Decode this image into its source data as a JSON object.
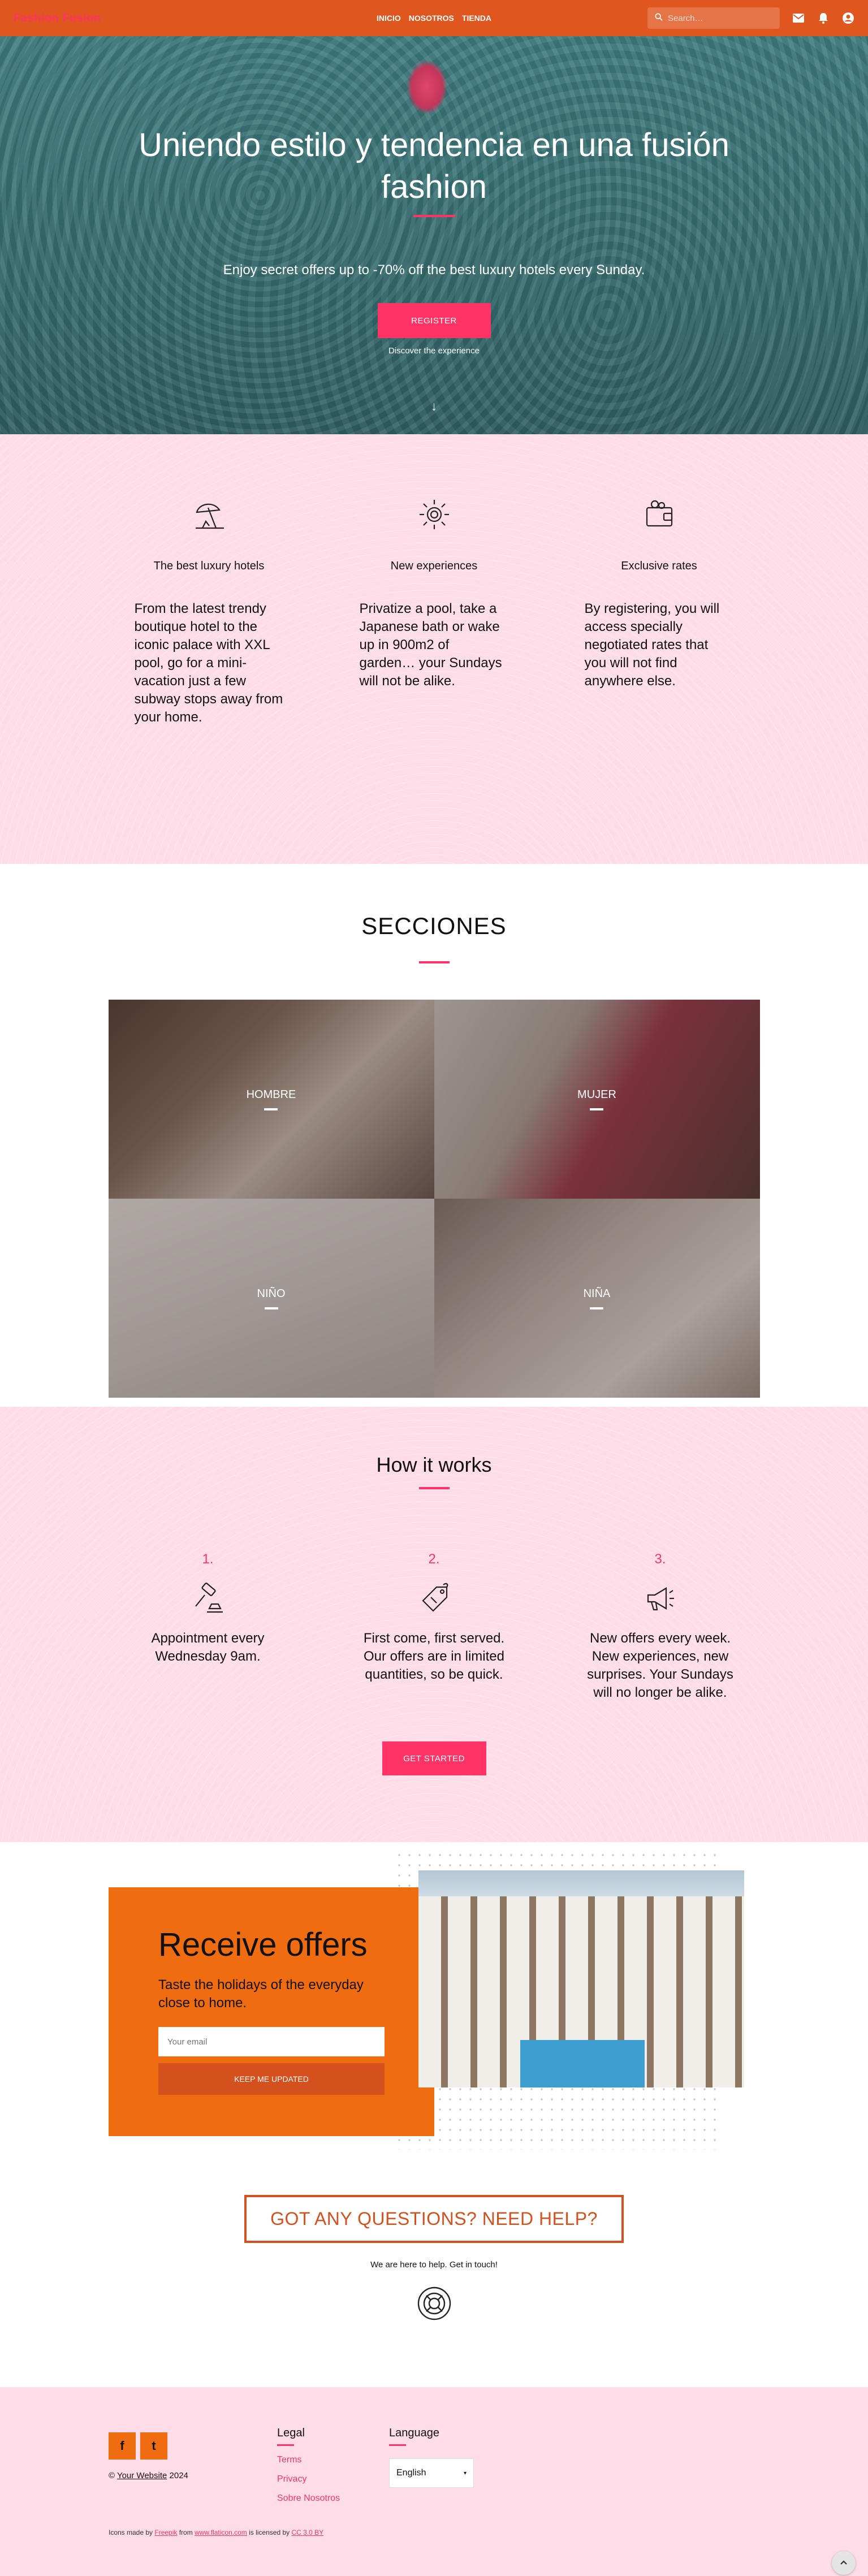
{
  "header": {
    "brand": "Fashion Fusion",
    "nav": [
      "INICIO",
      "NOSOTROS",
      "TIENDA"
    ],
    "search_placeholder": "Search…"
  },
  "hero": {
    "title": "Uniendo estilo y tendencia en una fusión fashion",
    "subtitle": "Enjoy secret offers up to -70% off the best luxury hotels every Sunday.",
    "cta": "REGISTER",
    "discover": "Discover the experience",
    "scroll_arrow": "↓"
  },
  "values": [
    {
      "icon": "beach-umbrella-icon",
      "title": "The best luxury hotels",
      "text": "From the latest trendy boutique hotel to the iconic palace with XXL pool, go for a mini-vacation just a few subway stops away from your home."
    },
    {
      "icon": "sun-icon",
      "title": "New experiences",
      "text": "Privatize a pool, take a Japanese bath or wake up in 900m2 of garden… your Sundays will not be alike."
    },
    {
      "icon": "wallet-icon",
      "title": "Exclusive rates",
      "text": "By registering, you will access specially negotiated rates that you will not find anywhere else."
    }
  ],
  "secciones": {
    "title": "SECCIONES",
    "tiles": [
      "HOMBRE",
      "MUJER",
      "NIÑO",
      "NIÑA"
    ]
  },
  "how": {
    "title": "How it works",
    "steps": [
      {
        "num": "1.",
        "icon": "gavel-icon",
        "text": "Appointment every Wednesday 9am."
      },
      {
        "num": "2.",
        "icon": "price-tag-icon",
        "text": "First come, first served. Our offers are in limited quantities, so be quick."
      },
      {
        "num": "3.",
        "icon": "megaphone-icon",
        "text": "New offers every week. New experiences, new surprises. Your Sundays will no longer be alike."
      }
    ],
    "cta": "GET STARTED"
  },
  "offers": {
    "title": "Receive offers",
    "text": "Taste the holidays of the everyday close to home.",
    "email_placeholder": "Your email",
    "button": "KEEP ME UPDATED"
  },
  "help": {
    "title": "GOT ANY QUESTIONS? NEED HELP?",
    "text": "We are here to help. Get in touch!",
    "icon": "lifebuoy-icon"
  },
  "footer": {
    "social": [
      "f",
      "t"
    ],
    "copyright_prefix": "© ",
    "copyright_link": "Your Website",
    "copyright_suffix": " 2024",
    "legal_title": "Legal",
    "legal_links": [
      "Terms",
      "Privacy",
      "Sobre Nosotros"
    ],
    "language_title": "Language",
    "language_value": "English",
    "credits": {
      "p1": "Icons made by ",
      "a1": "Freepik",
      "p2": " from ",
      "a2": "www.flaticon.com",
      "p3": " is licensed by ",
      "a3": "CC 3.0 BY"
    }
  },
  "colors": {
    "topbar": "#e0561f",
    "accent_pink": "#ff3366",
    "section_pink": "#fedde8",
    "offer_orange": "#ef6c10"
  }
}
